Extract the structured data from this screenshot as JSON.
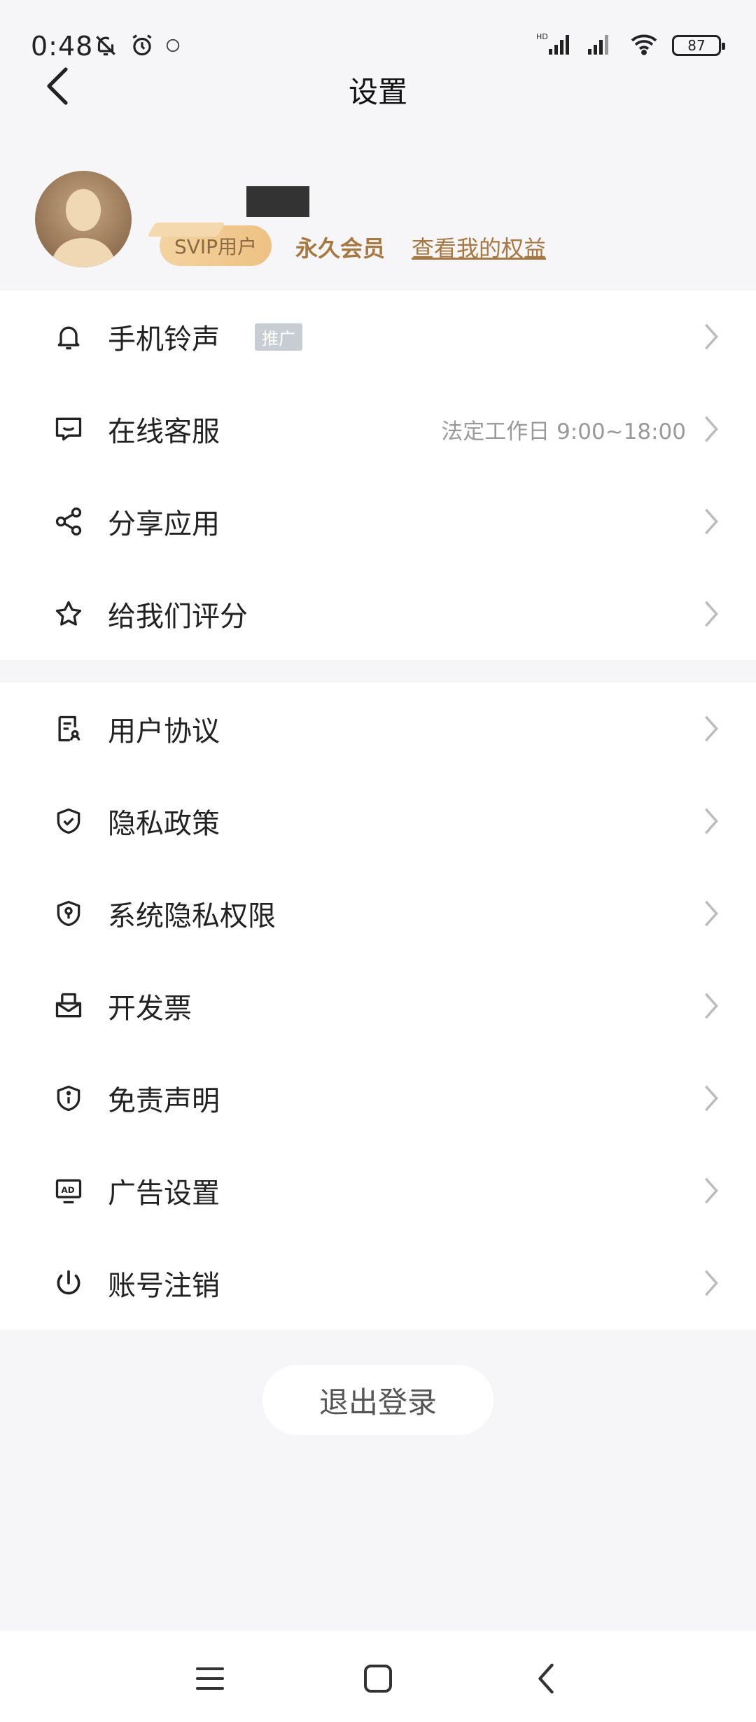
{
  "status_bar": {
    "time": "0:48",
    "battery": "87",
    "network_label": "HD"
  },
  "header": {
    "title": "设置"
  },
  "profile": {
    "badge": "SVIP用户",
    "member_level": "永久会员",
    "benefit_link": "查看我的权益"
  },
  "menu_group_1": [
    {
      "label": "手机铃声",
      "tag": "推广",
      "icon": "bell-icon"
    },
    {
      "label": "在线客服",
      "info": "法定工作日 9:00~18:00",
      "icon": "chat-icon"
    },
    {
      "label": "分享应用",
      "icon": "share-icon"
    },
    {
      "label": "给我们评分",
      "icon": "star-icon"
    }
  ],
  "menu_group_2": [
    {
      "label": "用户协议",
      "icon": "document-user-icon"
    },
    {
      "label": "隐私政策",
      "icon": "shield-check-icon"
    },
    {
      "label": "系统隐私权限",
      "icon": "shield-key-icon"
    },
    {
      "label": "开发票",
      "icon": "invoice-icon"
    },
    {
      "label": "免责声明",
      "icon": "shield-info-icon"
    },
    {
      "label": "广告设置",
      "icon": "ad-icon"
    },
    {
      "label": "账号注销",
      "icon": "power-icon"
    }
  ],
  "logout": {
    "label": "退出登录"
  },
  "colors": {
    "accent_gold": "#a7783f",
    "background": "#f6f6f9"
  }
}
